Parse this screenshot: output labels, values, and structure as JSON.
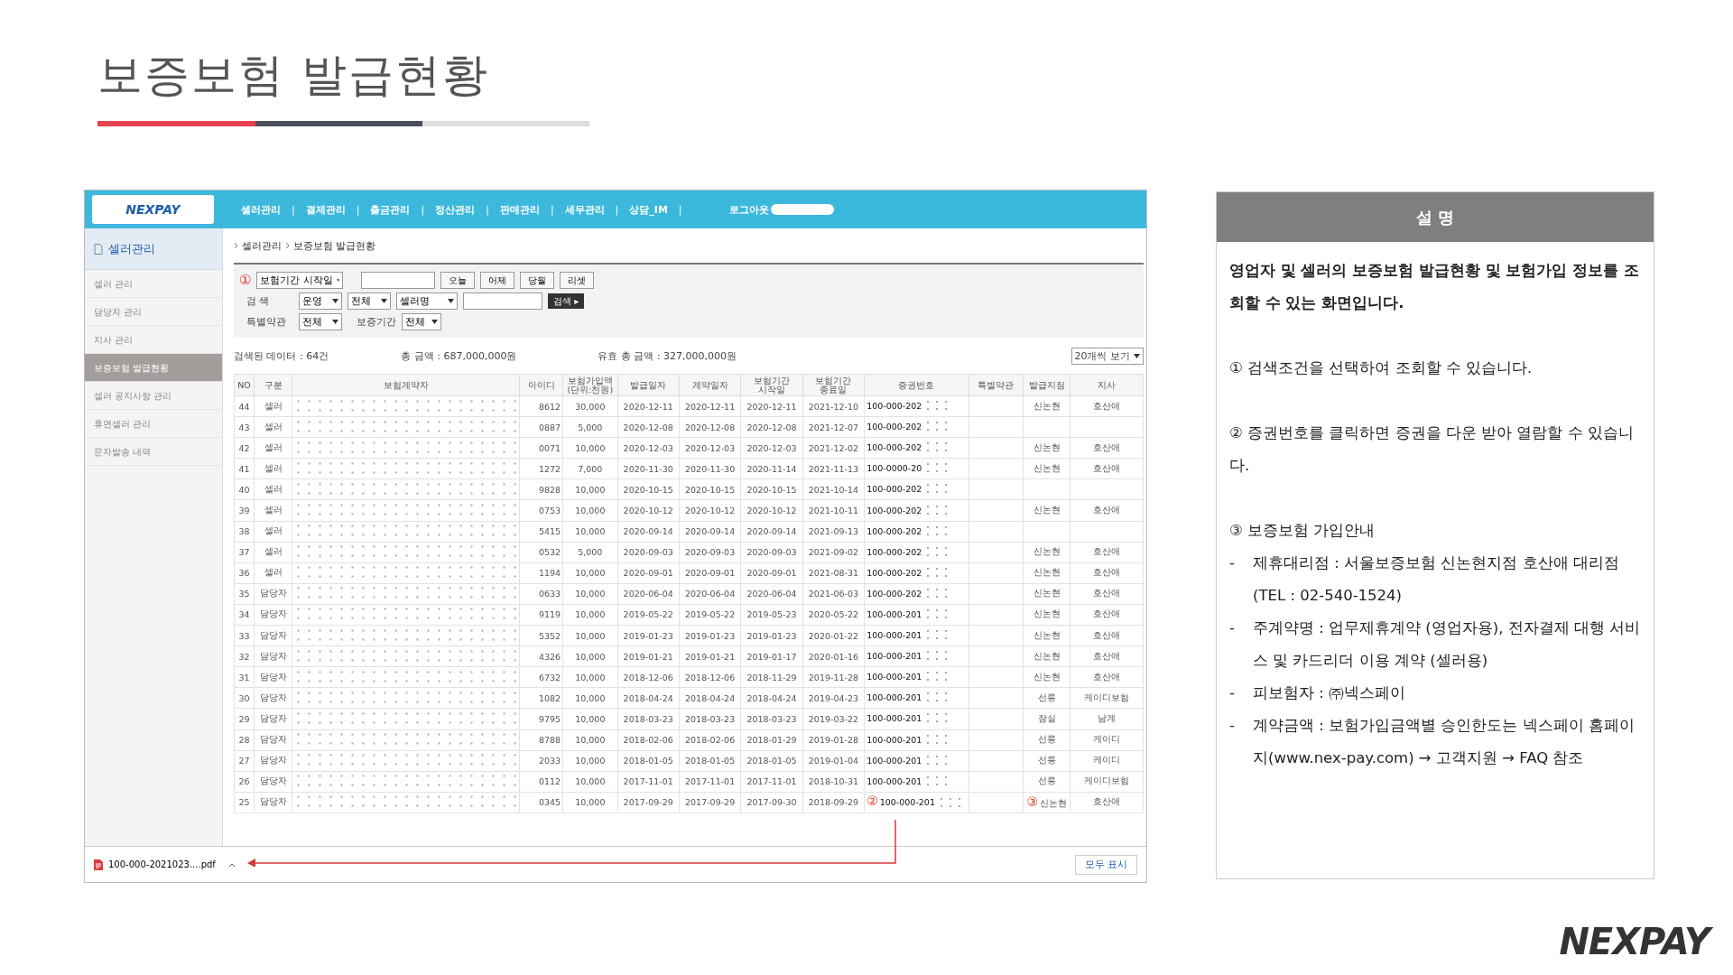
{
  "slide": {
    "title": "보증보험 발급현황",
    "logo": "NEXPAY"
  },
  "app": {
    "logo": "NEXPAY",
    "nav": [
      {
        "label": "셀러관리",
        "sep": "|"
      },
      {
        "label": "결제관리",
        "sep": "|"
      },
      {
        "label": "출금관리",
        "sep": "|"
      },
      {
        "label": "정산관리",
        "sep": "|"
      },
      {
        "label": "판매관리",
        "sep": "|"
      },
      {
        "label": "세무관리",
        "sep": "|"
      },
      {
        "label": "상담_IM",
        "sep": "|"
      }
    ],
    "logout": "로그아웃",
    "sidebar": {
      "title": "셀러관리",
      "items": [
        {
          "label": "셀러 관리",
          "selected": false
        },
        {
          "label": "담당자 관리",
          "selected": false
        },
        {
          "label": "지사 관리",
          "selected": false
        },
        {
          "label": "보증보험 발급현황",
          "selected": true
        },
        {
          "label": "셀러 공지사항 관리",
          "selected": false
        },
        {
          "label": "휴면셀러 관리",
          "selected": false
        },
        {
          "label": "문자발송 내역",
          "selected": false
        }
      ]
    },
    "breadcrumb": [
      "셀러관리",
      "보증보험 발급현황"
    ],
    "filters": {
      "callout": "①",
      "date_select": "보험기간 시작일",
      "date_buttons": [
        "오늘",
        "어제",
        "당월",
        "리셋"
      ],
      "search_label": "검 색",
      "search_selects": [
        "운영",
        "전체",
        "셀러명"
      ],
      "search_button": "검색 ▸",
      "special_label": "특별약관",
      "special_select": "전체",
      "period_label": "보증기간",
      "period_select": "전체"
    },
    "summary": {
      "count": "검색된 데이터 : 64건",
      "total": "총 금액 : 687,000,000원",
      "valid_total": "유효 총 금액 : 327,000,000원",
      "page_size": "20개씩 보기"
    },
    "table": {
      "columns": [
        "NO",
        "구분",
        "보험계약자",
        "아이디",
        "보험가입액\n(단위:천원)",
        "발급일자",
        "계약일자",
        "보험기간\n시작일",
        "보험기간\n종료일",
        "증권번호",
        "특별약관",
        "발급지점",
        "지사"
      ],
      "rows": [
        {
          "no": "44",
          "type": "셀러",
          "id": "8612",
          "amount": "30,000",
          "issued": "2020-12-11",
          "contract": "2020-12-11",
          "start": "2020-12-11",
          "end": "2021-12-10",
          "cert": "100-000-202",
          "branch": "신논현",
          "office": "호산애"
        },
        {
          "no": "43",
          "type": "셀러",
          "id": "0887",
          "amount": "5,000",
          "issued": "2020-12-08",
          "contract": "2020-12-08",
          "start": "2020-12-08",
          "end": "2021-12-07",
          "cert": "100-000-202"
        },
        {
          "no": "42",
          "type": "셀러",
          "id": "0071",
          "amount": "10,000",
          "issued": "2020-12-03",
          "contract": "2020-12-03",
          "start": "2020-12-03",
          "end": "2021-12-02",
          "cert": "100-000-202",
          "branch": "신논현",
          "office": "호산애"
        },
        {
          "no": "41",
          "type": "셀러",
          "id": "1272",
          "amount": "7,000",
          "issued": "2020-11-30",
          "contract": "2020-11-30",
          "start": "2020-11-14",
          "end": "2021-11-13",
          "cert": "100-0000-20",
          "branch": "신논현",
          "office": "호산애"
        },
        {
          "no": "40",
          "type": "셀러",
          "id": "9828",
          "amount": "10,000",
          "issued": "2020-10-15",
          "contract": "2020-10-15",
          "start": "2020-10-15",
          "end": "2021-10-14",
          "cert": "100-000-202"
        },
        {
          "no": "39",
          "type": "셀러",
          "id": "0753",
          "amount": "10,000",
          "issued": "2020-10-12",
          "contract": "2020-10-12",
          "start": "2020-10-12",
          "end": "2021-10-11",
          "cert": "100-000-202",
          "branch": "신논현",
          "office": "호산애"
        },
        {
          "no": "38",
          "type": "셀러",
          "id": "5415",
          "amount": "10,000",
          "issued": "2020-09-14",
          "contract": "2020-09-14",
          "start": "2020-09-14",
          "end": "2021-09-13",
          "cert": "100-000-202"
        },
        {
          "no": "37",
          "type": "셀러",
          "id": "0532",
          "amount": "5,000",
          "issued": "2020-09-03",
          "contract": "2020-09-03",
          "start": "2020-09-03",
          "end": "2021-09-02",
          "cert": "100-000-202",
          "branch": "신논현",
          "office": "호산애"
        },
        {
          "no": "36",
          "type": "셀러",
          "id": "1194",
          "amount": "10,000",
          "issued": "2020-09-01",
          "contract": "2020-09-01",
          "start": "2020-09-01",
          "end": "2021-08-31",
          "cert": "100-000-202",
          "branch": "신논현",
          "office": "호산애"
        },
        {
          "no": "35",
          "type": "담당자",
          "id": "0633",
          "amount": "10,000",
          "issued": "2020-06-04",
          "contract": "2020-06-04",
          "start": "2020-06-04",
          "end": "2021-06-03",
          "cert": "100-000-202",
          "branch": "신논현",
          "office": "호산애"
        },
        {
          "no": "34",
          "type": "담당자",
          "id": "9119",
          "amount": "10,000",
          "issued": "2019-05-22",
          "contract": "2019-05-22",
          "start": "2019-05-23",
          "end": "2020-05-22",
          "cert": "100-000-201",
          "branch": "신논현",
          "office": "호산애"
        },
        {
          "no": "33",
          "type": "담당자",
          "id": "5352",
          "amount": "10,000",
          "issued": "2019-01-23",
          "contract": "2019-01-23",
          "start": "2019-01-23",
          "end": "2020-01-22",
          "cert": "100-000-201",
          "branch": "신논현",
          "office": "호산애"
        },
        {
          "no": "32",
          "type": "담당자",
          "id": "4326",
          "amount": "10,000",
          "issued": "2019-01-21",
          "contract": "2019-01-21",
          "start": "2019-01-17",
          "end": "2020-01-16",
          "cert": "100-000-201",
          "branch": "신논현",
          "office": "호산애"
        },
        {
          "no": "31",
          "type": "담당자",
          "id": "6732",
          "amount": "10,000",
          "issued": "2018-12-06",
          "contract": "2018-12-06",
          "start": "2018-11-29",
          "end": "2019-11-28",
          "cert": "100-000-201",
          "branch": "신논현",
          "office": "호산애"
        },
        {
          "no": "30",
          "type": "담당자",
          "id": "1082",
          "amount": "10,000",
          "issued": "2018-04-24",
          "contract": "2018-04-24",
          "start": "2018-04-24",
          "end": "2019-04-23",
          "cert": "100-000-201",
          "branch": "선릉",
          "office": "케이디보험"
        },
        {
          "no": "29",
          "type": "담당자",
          "id": "9795",
          "amount": "10,000",
          "issued": "2018-03-23",
          "contract": "2018-03-23",
          "start": "2018-03-23",
          "end": "2019-03-22",
          "cert": "100-000-201",
          "branch": "잠실",
          "office": "남계"
        },
        {
          "no": "28",
          "type": "담당자",
          "id": "8788",
          "amount": "10,000",
          "issued": "2018-02-06",
          "contract": "2018-02-06",
          "start": "2018-01-29",
          "end": "2019-01-28",
          "cert": "100-000-201",
          "branch": "선릉",
          "office": "케이디"
        },
        {
          "no": "27",
          "type": "담당자",
          "id": "2033",
          "amount": "10,000",
          "issued": "2018-01-05",
          "contract": "2018-01-05",
          "start": "2018-01-05",
          "end": "2019-01-04",
          "cert": "100-000-201",
          "branch": "선릉",
          "office": "케이디"
        },
        {
          "no": "26",
          "type": "담당자",
          "id": "0112",
          "amount": "10,000",
          "issued": "2017-11-01",
          "contract": "2017-11-01",
          "start": "2017-11-01",
          "end": "2018-10-31",
          "cert": "100-000-201",
          "branch": "선릉",
          "office": "케이디보험"
        },
        {
          "no": "25",
          "type": "담당자",
          "id": "0345",
          "amount": "10,000",
          "issued": "2017-09-29",
          "contract": "2017-09-29",
          "start": "2017-09-30",
          "end": "2018-09-29",
          "cert": "100-000-201",
          "branch": "신논현",
          "office": "호산애",
          "cert_callout": "②",
          "branch_callout": "③"
        }
      ]
    },
    "download": {
      "file": "100-000-2021023....pdf",
      "show_all": "모두 표시"
    }
  },
  "description": {
    "title": "설 명",
    "intro": "영업자 및 셀러의 보증보험 발급현황 및 보험가입 정보를 조회할 수 있는 화면입니다.",
    "items": [
      {
        "marker": "①",
        "text": "검색조건을 선택하여 조회할 수 있습니다."
      },
      {
        "marker": "②",
        "text": "증권번호를 클릭하면 증권을 다운 받아 열람할 수 있습니다."
      },
      {
        "marker": "③",
        "text": "보증보험 가입안내",
        "bullets": [
          {
            "dash": "-",
            "text": "제휴대리점 : 서울보증보험 신논현지점 호산애 대리점 (TEL : 02-540-1524)"
          },
          {
            "dash": "-",
            "text": "주계약명 : 업무제휴계약 (영업자용), 전자결제 대행 서비스 및 카드리더 이용 계약 (셀러용)"
          },
          {
            "dash": "-",
            "text": "피보험자 : ㈜넥스페이"
          },
          {
            "dash": "-",
            "text": "계약금액 : 보험가입금액별 승인한도는 넥스페이 홈페이지(www.nex-pay.com) → 고객지원 → FAQ 참조"
          }
        ]
      }
    ]
  }
}
